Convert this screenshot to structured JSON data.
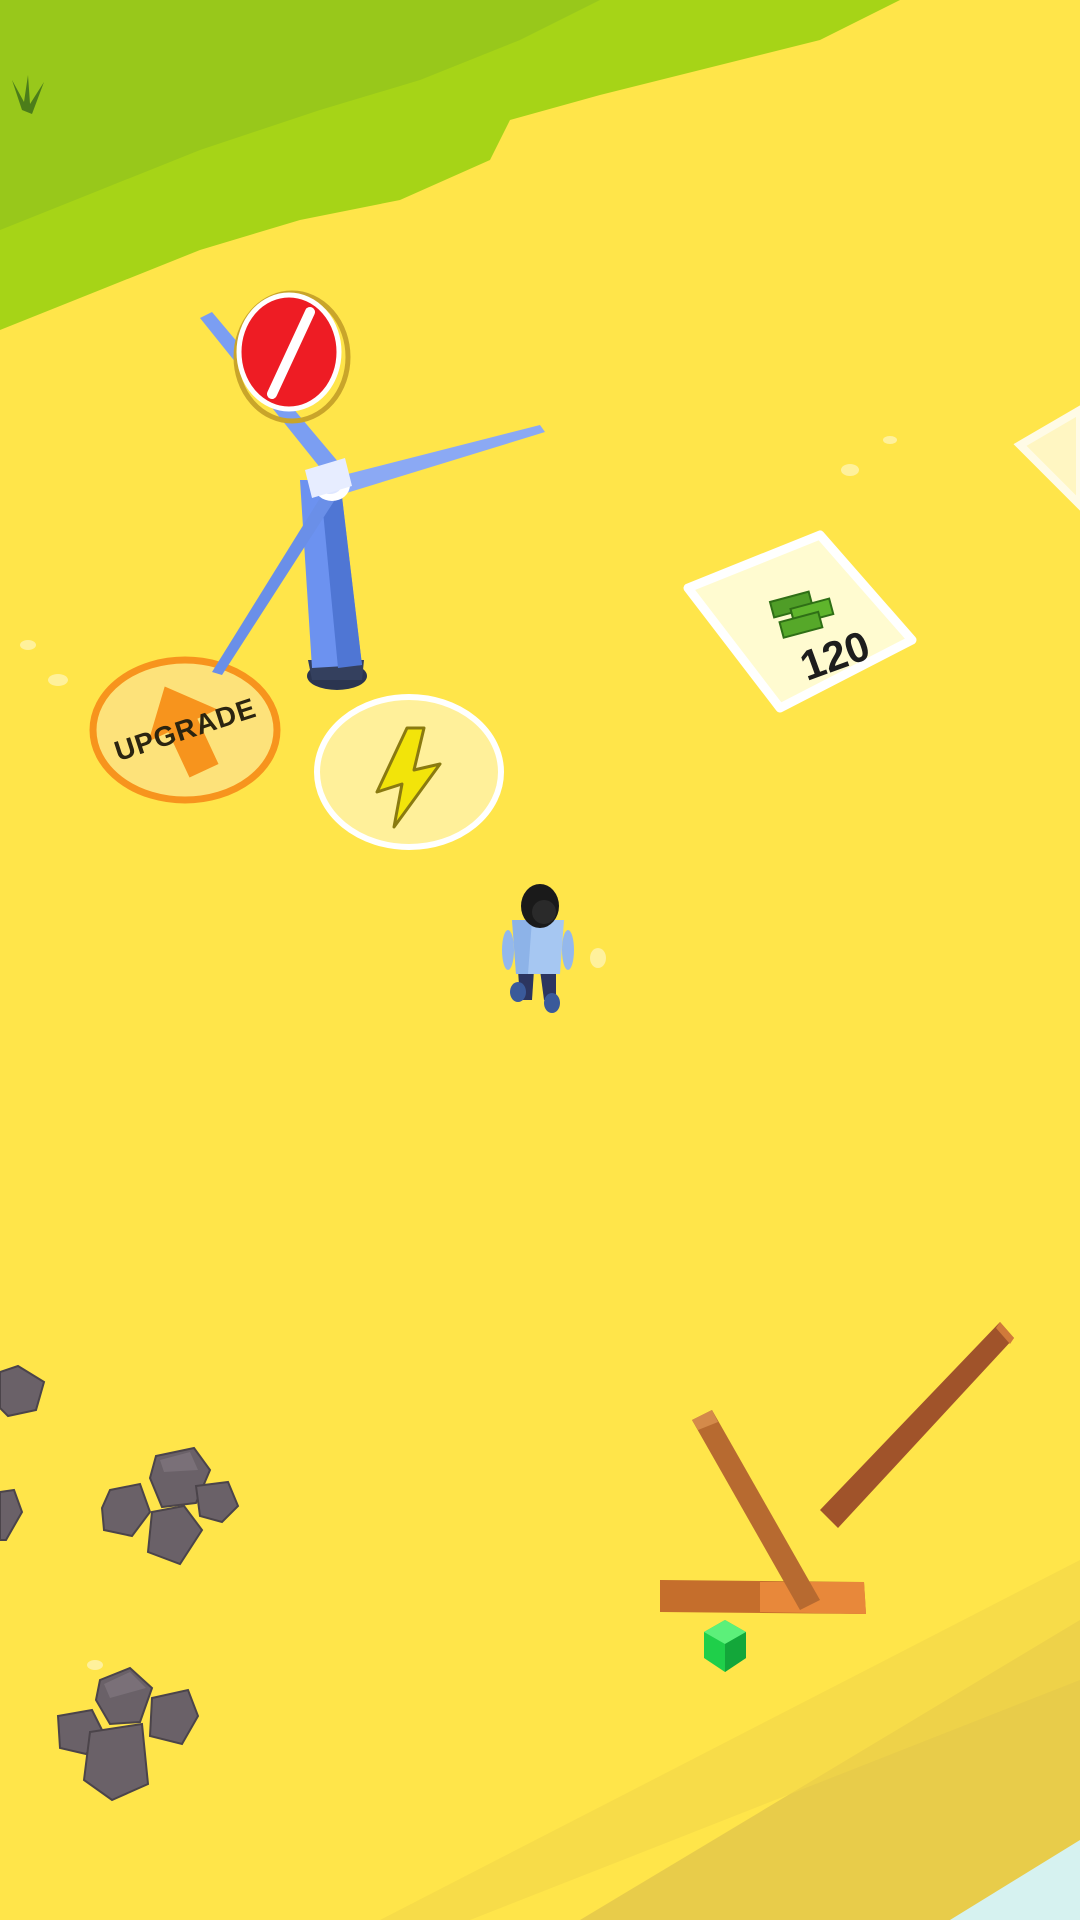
{
  "upgrade_pad": {
    "label": "UPGRADE"
  },
  "purchase_tile": {
    "price": "120",
    "currency_icon": "cash-stack-icon"
  },
  "icons": {
    "turbine_status": "no-entry-icon",
    "power_pad": "lightning-bolt-icon",
    "player": "player-character",
    "gem": "green-gem-icon"
  },
  "colors": {
    "sand": "#ffe54a",
    "grass": "#a7d81a",
    "upgrade_ring": "#f7941d",
    "status_red": "#ee1c24",
    "turbine_blue": "#5e86e6",
    "gem_green": "#1fcf4a"
  }
}
